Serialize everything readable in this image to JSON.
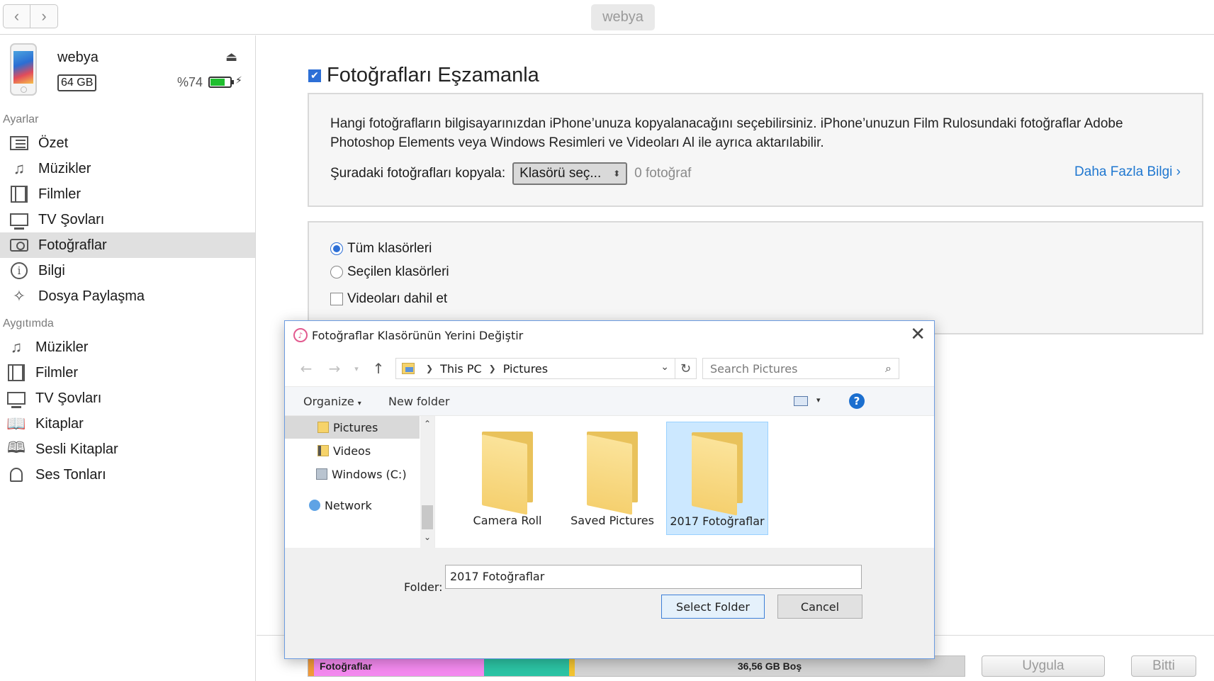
{
  "titlebar": {
    "device_name": "webya",
    "back_icon": "chevron-left-icon",
    "forward_icon": "chevron-right-icon"
  },
  "sidebar": {
    "device": {
      "name": "webya",
      "capacity": "64 GB",
      "battery_pct": "%74",
      "battery_level": 0.74
    },
    "settings_label": "Ayarlar",
    "settings_items": [
      {
        "label": "Özet",
        "icon": "list-icon"
      },
      {
        "label": "Müzikler",
        "icon": "music-note-icon"
      },
      {
        "label": "Filmler",
        "icon": "film-icon"
      },
      {
        "label": "TV Şovları",
        "icon": "tv-icon"
      },
      {
        "label": "Fotoğraflar",
        "icon": "camera-icon",
        "active": true
      },
      {
        "label": "Bilgi",
        "icon": "info-icon"
      },
      {
        "label": "Dosya Paylaşma",
        "icon": "app-store-icon"
      }
    ],
    "device_label": "Aygıtımda",
    "device_items": [
      {
        "label": "Müzikler",
        "icon": "music-note-icon"
      },
      {
        "label": "Filmler",
        "icon": "film-icon"
      },
      {
        "label": "TV Şovları",
        "icon": "tv-icon"
      },
      {
        "label": "Kitaplar",
        "icon": "book-icon"
      },
      {
        "label": "Sesli Kitaplar",
        "icon": "audiobook-icon"
      },
      {
        "label": "Ses Tonları",
        "icon": "bell-icon"
      }
    ]
  },
  "main": {
    "sync_title": "Fotoğrafları Eşzamanla",
    "sync_checked": true,
    "description": "Hangi fotoğrafların bilgisayarınızdan iPhone’unuza kopyalanacağını seçebilirsiniz. iPhone’unuzun Film Rulosundaki fotoğraflar Adobe Photoshop Elements veya Windows Resimleri ve Videoları Al ile ayrıca aktarılabilir.",
    "copy_label": "Şuradaki fotoğrafları kopyala:",
    "select_value": "Klasörü seç...",
    "photo_count": "0 fotoğraf",
    "more_info": "Daha Fazla Bilgi",
    "options": {
      "all_folders": "Tüm klasörleri",
      "selected_folders": "Seçilen klasörleri",
      "include_videos": "Videoları dahil et"
    }
  },
  "storage": {
    "photos_label": "Fotoğraflar",
    "free_label": "36,56 GB Boş",
    "colors": {
      "orange": "#f39b3a",
      "pink": "#f58af0",
      "teal": "#2cc5a5",
      "yellow": "#f4c531",
      "gray": "#d5d5d5"
    }
  },
  "footer": {
    "apply": "Uygula",
    "done": "Bitti"
  },
  "dialog": {
    "title": "Fotoğraflar Klasörünün Yerini Değiştir",
    "breadcrumb": [
      "This PC",
      "Pictures"
    ],
    "search_placeholder": "Search Pictures",
    "organize": "Organize",
    "new_folder": "New folder",
    "help": "?",
    "nav_items": [
      {
        "label": "Pictures",
        "icon": "pictures-folder-icon",
        "selected": true
      },
      {
        "label": "Videos",
        "icon": "videos-folder-icon"
      },
      {
        "label": "Windows (C:)",
        "icon": "drive-icon"
      },
      {
        "label": "Network",
        "icon": "network-icon"
      }
    ],
    "files": [
      {
        "label": "Camera Roll"
      },
      {
        "label": "Saved Pictures"
      },
      {
        "label": "2017 Fotoğraflar",
        "selected": true
      }
    ],
    "folder_label": "Folder:",
    "folder_value": "2017 Fotoğraflar",
    "select_button": "Select Folder",
    "cancel_button": "Cancel"
  }
}
